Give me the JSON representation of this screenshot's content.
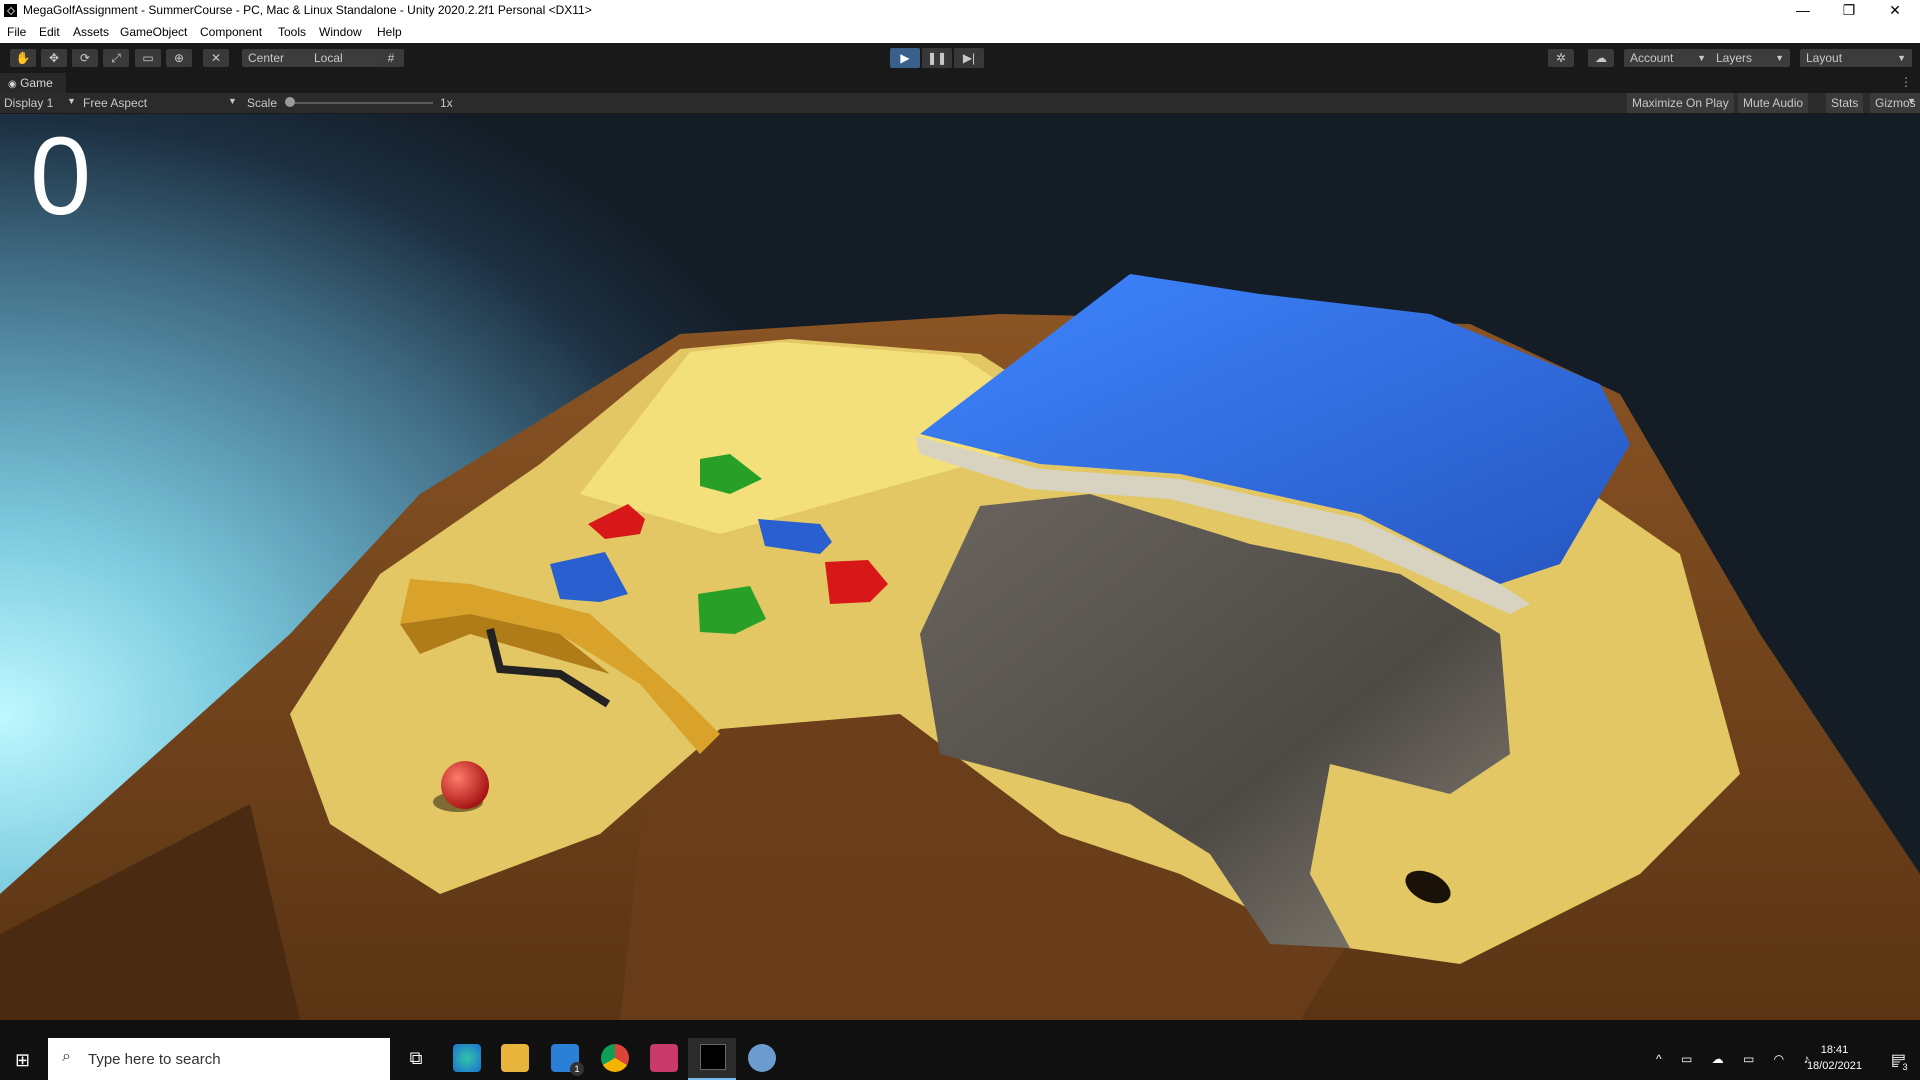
{
  "window": {
    "title": "MegaGolfAssignment - SummerCourse - PC, Mac & Linux Standalone - Unity 2020.2.2f1 Personal <DX11>",
    "minimize": "—",
    "restore": "❐",
    "close": "✕"
  },
  "menu": [
    "File",
    "Edit",
    "Assets",
    "GameObject",
    "Component",
    "Tools",
    "Window",
    "Help"
  ],
  "toolbar": {
    "pivot_label": "Center",
    "space_label": "Local",
    "account_label": "Account",
    "layers_label": "Layers",
    "layout_label": "Layout",
    "play_state": "playing"
  },
  "game_view": {
    "tab_label": "Game",
    "display": "Display 1",
    "aspect": "Free Aspect",
    "scale_label": "Scale",
    "scale_value": "1x",
    "maximize_on_play": "Maximize On Play",
    "mute_audio": "Mute Audio",
    "stats": "Stats",
    "gizmos": "Gizmos",
    "score": "0"
  },
  "taskbar": {
    "search_placeholder": "Type here to search",
    "time": "18:41",
    "date": "18/02/2021",
    "notification_count": "3",
    "mail_badge": "1"
  },
  "colors": {
    "sand": "#e3c765",
    "dirt": "#7a4a22",
    "water": "#2f6fe0",
    "rock": "#555049",
    "accent_blue": "#3a5f8a"
  }
}
